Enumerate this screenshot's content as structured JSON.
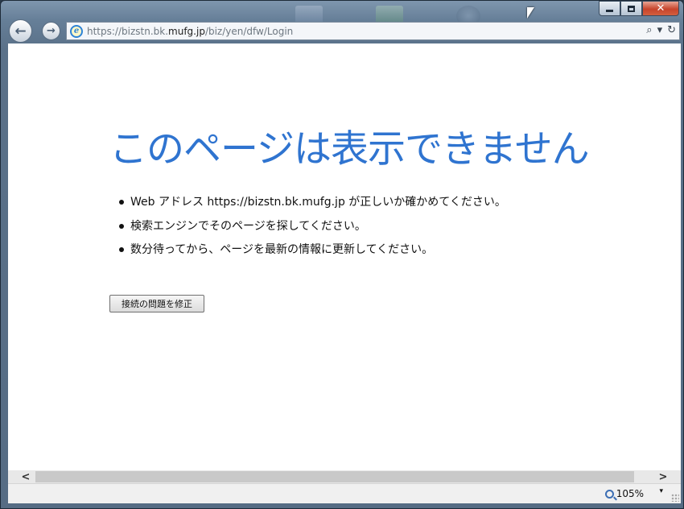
{
  "window": {
    "caption_min": "",
    "caption_max": "",
    "caption_close": "✕"
  },
  "nav": {
    "back_icon": "arrow-left-icon",
    "forward_icon": "arrow-right-icon",
    "url_prefix": "https://bizstn.bk.",
    "url_host": "mufg.jp",
    "url_path": "/biz/yen/dfw/Login",
    "search_glyph": "⌕",
    "dropdown_glyph": "▾",
    "refresh_glyph": "↻"
  },
  "content": {
    "title": "このページは表示できません",
    "suggestions": [
      "Web アドレス https://bizstn.bk.mufg.jp が正しいか確かめてください。",
      "検索エンジンでそのページを探してください。",
      "数分待ってから、ページを最新の情報に更新してください。"
    ],
    "fix_button": "接続の問題を修正"
  },
  "scrollbar": {
    "left_glyph": "<",
    "right_glyph": ">"
  },
  "status": {
    "zoom": "105%",
    "zoom_dropdown": "▾"
  },
  "colors": {
    "title": "#2f74d0",
    "frame": "#667f98"
  }
}
